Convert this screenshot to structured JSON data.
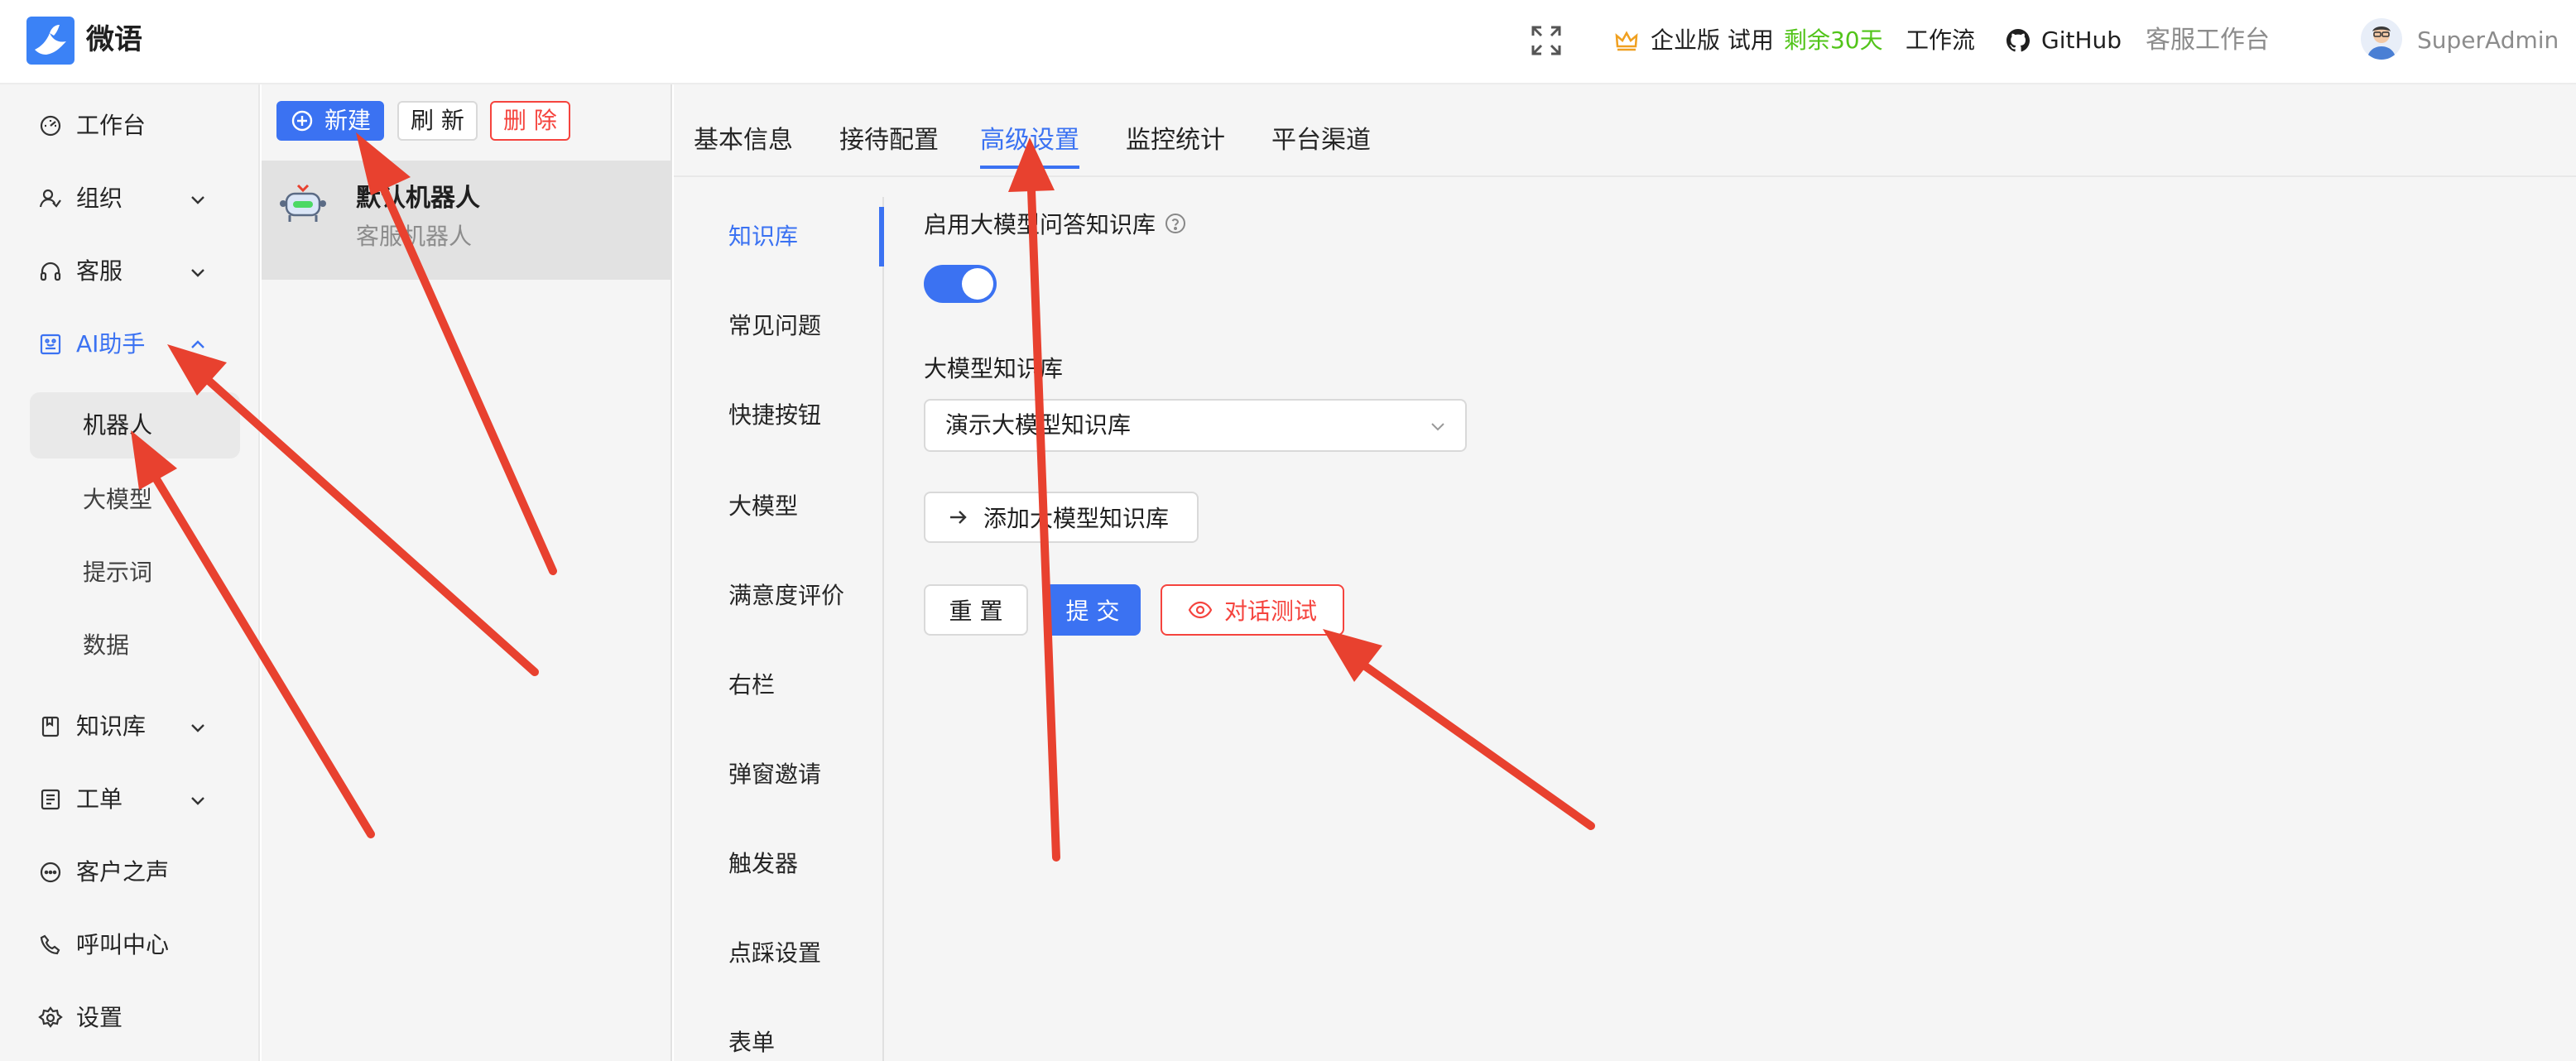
{
  "header": {
    "app_name": "微语",
    "edition": "企业版",
    "trial_label": "试用",
    "trial_remaining": "剩余30天",
    "workflow": "工作流",
    "github": "GitHub",
    "agent_workspace": "客服工作台",
    "user_name": "SuperAdmin",
    "icons": [
      "logo-icon",
      "fullscreen-icon",
      "crown-icon",
      "github-icon",
      "avatar"
    ]
  },
  "nav": {
    "items": [
      {
        "label": "工作台",
        "icon": "dashboard-icon",
        "expandable": false
      },
      {
        "label": "组织",
        "icon": "user-group-icon",
        "expandable": true
      },
      {
        "label": "客服",
        "icon": "headset-icon",
        "expandable": true
      },
      {
        "label": "AI助手",
        "icon": "ai-assistant-icon",
        "expandable": true,
        "expanded": true
      },
      {
        "label": "知识库",
        "icon": "book-icon",
        "expandable": true
      },
      {
        "label": "工单",
        "icon": "ticket-icon",
        "expandable": true
      },
      {
        "label": "客户之声",
        "icon": "chat-bubble-icon",
        "expandable": false
      },
      {
        "label": "呼叫中心",
        "icon": "phone-icon",
        "expandable": false
      },
      {
        "label": "设置",
        "icon": "gear-icon",
        "expandable": false
      }
    ],
    "ai_submenu": [
      "机器人",
      "大模型",
      "提示词",
      "数据"
    ],
    "active_submenu": "机器人"
  },
  "robot_list": {
    "new_label": "新建",
    "refresh_label": "刷 新",
    "delete_label": "删 除",
    "items": [
      {
        "name": "默认机器人",
        "desc": "客服机器人",
        "icon": "robot-icon"
      }
    ]
  },
  "main": {
    "tabs": [
      "基本信息",
      "接待配置",
      "高级设置",
      "监控统计",
      "平台渠道"
    ],
    "active_tab": "高级设置",
    "side_menu": [
      "知识库",
      "常见问题",
      "快捷按钮",
      "大模型",
      "满意度评价",
      "右栏",
      "弹窗邀请",
      "触发器",
      "点踩设置",
      "表单"
    ],
    "active_side": "知识库",
    "form": {
      "enable_llm_label": "启用大模型问答知识库",
      "enable_llm_value": true,
      "kb_label": "大模型知识库",
      "kb_selected": "演示大模型知识库",
      "add_kb_label": "添加大模型知识库",
      "reset_label": "重 置",
      "submit_label": "提 交",
      "test_label": "对话测试"
    }
  },
  "colors": {
    "primary": "#3b72f2",
    "danger": "#f5443e",
    "success": "#52c41a",
    "annotation_arrow": "#e8412f"
  }
}
